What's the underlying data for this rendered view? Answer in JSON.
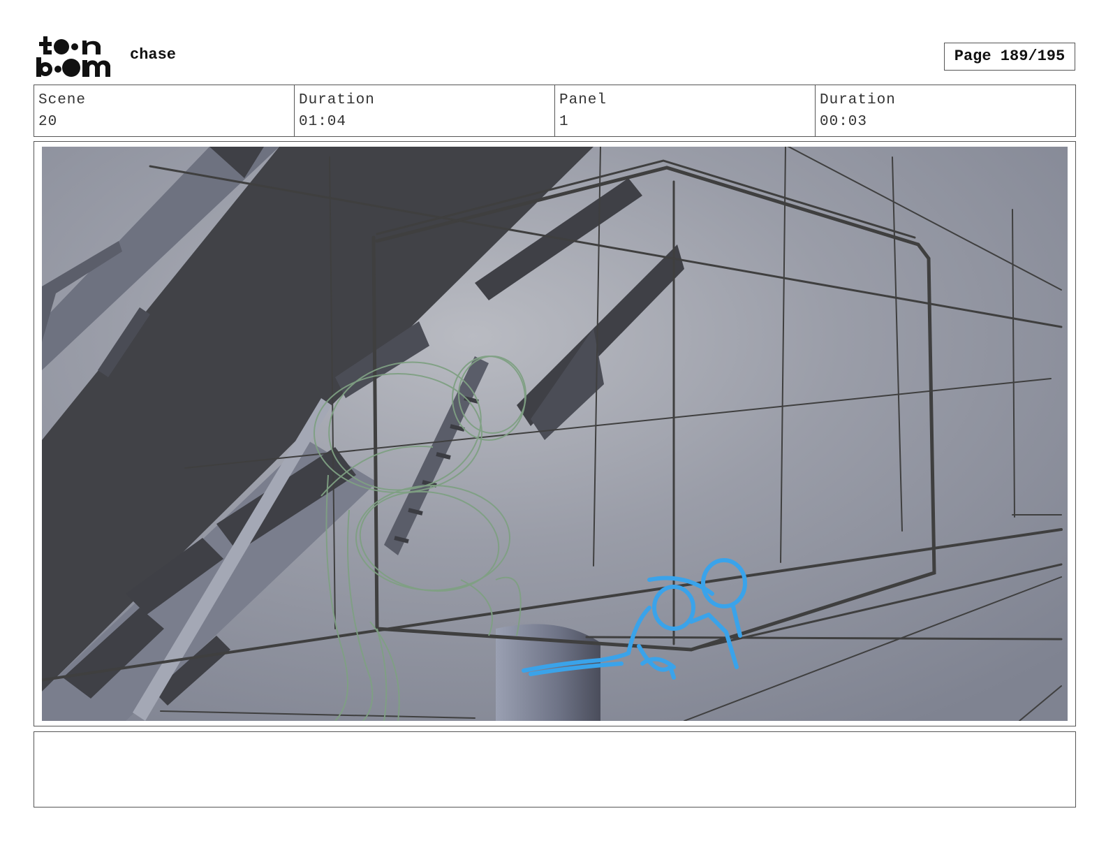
{
  "header": {
    "logo_text": "toon boom",
    "project_title": "chase",
    "page_label": "Page 189/195"
  },
  "info": {
    "scene_label": "Scene",
    "scene_value": "20",
    "scene_duration_label": "Duration",
    "scene_duration_value": "01:04",
    "panel_label": "Panel",
    "panel_value": "1",
    "panel_duration_label": "Duration",
    "panel_duration_value": "00:03"
  },
  "panel": {
    "background_color": "#8a8e9b",
    "sketch_green": "#7fa083",
    "sketch_blue": "#3aa3ea",
    "line_color": "#3f3f3f"
  },
  "notes": {
    "text": ""
  }
}
